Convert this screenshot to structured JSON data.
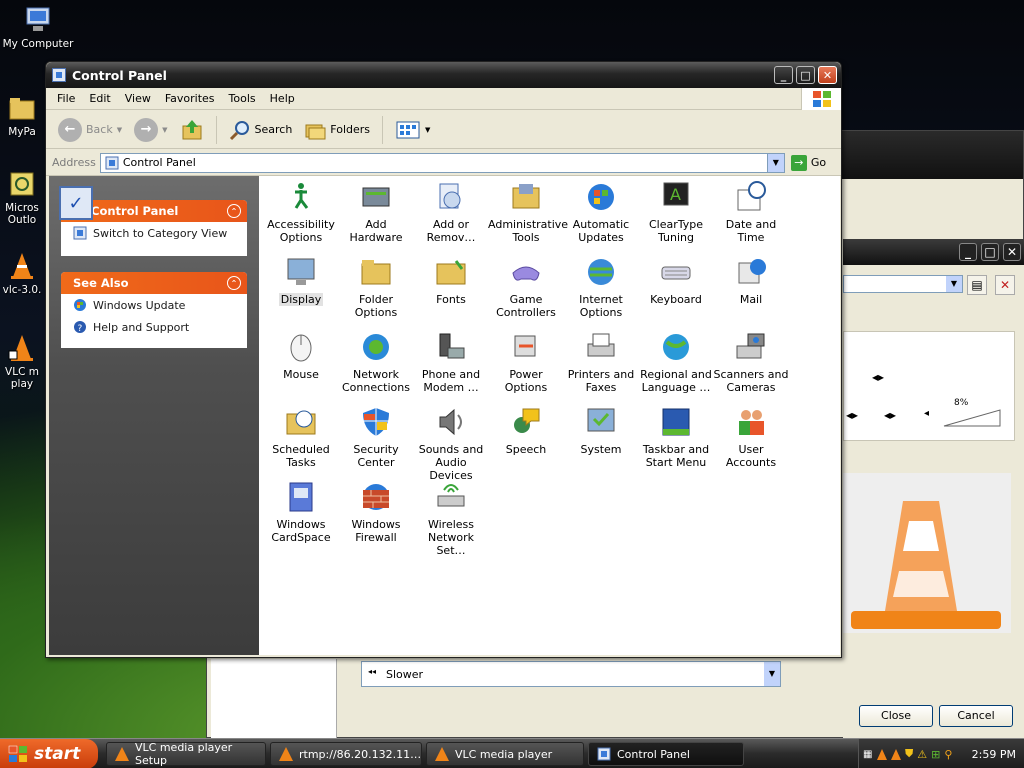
{
  "desktop": {
    "icons": [
      {
        "label": "My Computer",
        "icon": "my-computer-icon"
      },
      {
        "label": "MyPa",
        "icon": "folder-icon"
      },
      {
        "label": "Micros Outlo",
        "icon": "outlook-icon"
      },
      {
        "label": "vlc-3.0.",
        "icon": "vlc-cone-icon"
      },
      {
        "label": "VLC m play",
        "icon": "vlc-shortcut-icon"
      }
    ]
  },
  "control_panel": {
    "title": "Control Panel",
    "menu": [
      "File",
      "Edit",
      "View",
      "Favorites",
      "Tools",
      "Help"
    ],
    "toolbar": {
      "back": "Back",
      "search": "Search",
      "folders": "Folders"
    },
    "address": {
      "label": "Address",
      "value": "Control Panel",
      "go": "Go"
    },
    "pane": {
      "control_panel_header": "Control Panel",
      "switch_view": "Switch to Category View",
      "see_also_header": "See Also",
      "see_also_items": [
        "Windows Update",
        "Help and Support"
      ]
    },
    "items": [
      {
        "label": "Accessibility Options",
        "icon": "accessibility-icon"
      },
      {
        "label": "Add Hardware",
        "icon": "add-hardware-icon"
      },
      {
        "label": "Add or Remov…",
        "icon": "add-remove-programs-icon"
      },
      {
        "label": "Administrative Tools",
        "icon": "administrative-tools-icon"
      },
      {
        "label": "Automatic Updates",
        "icon": "automatic-updates-icon"
      },
      {
        "label": "ClearType Tuning",
        "icon": "cleartype-icon"
      },
      {
        "label": "Date and Time",
        "icon": "date-time-icon"
      },
      {
        "label": "Display",
        "icon": "display-icon"
      },
      {
        "label": "Folder Options",
        "icon": "folder-options-icon"
      },
      {
        "label": "Fonts",
        "icon": "fonts-icon"
      },
      {
        "label": "Game Controllers",
        "icon": "game-controller-icon"
      },
      {
        "label": "Internet Options",
        "icon": "internet-options-icon"
      },
      {
        "label": "Keyboard",
        "icon": "keyboard-icon"
      },
      {
        "label": "Mail",
        "icon": "mail-icon"
      },
      {
        "label": "Mouse",
        "icon": "mouse-icon"
      },
      {
        "label": "Network Connections",
        "icon": "network-connections-icon"
      },
      {
        "label": "Phone and Modem …",
        "icon": "phone-modem-icon"
      },
      {
        "label": "Power Options",
        "icon": "power-options-icon"
      },
      {
        "label": "Printers and Faxes",
        "icon": "printer-icon"
      },
      {
        "label": "Regional and Language …",
        "icon": "regional-language-icon"
      },
      {
        "label": "Scanners and Cameras",
        "icon": "scanner-camera-icon"
      },
      {
        "label": "Scheduled Tasks",
        "icon": "scheduled-tasks-icon"
      },
      {
        "label": "Security Center",
        "icon": "security-center-icon"
      },
      {
        "label": "Sounds and Audio Devices",
        "icon": "speaker-icon"
      },
      {
        "label": "Speech",
        "icon": "speech-icon"
      },
      {
        "label": "System",
        "icon": "system-icon"
      },
      {
        "label": "Taskbar and Start Menu",
        "icon": "taskbar-icon"
      },
      {
        "label": "User Accounts",
        "icon": "user-accounts-icon"
      },
      {
        "label": "Windows CardSpace",
        "icon": "cardspace-icon"
      },
      {
        "label": "Windows Firewall",
        "icon": "firewall-icon"
      },
      {
        "label": "Wireless Network Set…",
        "icon": "wireless-network-icon"
      }
    ]
  },
  "vlc_dialog": {
    "list_value": "Slower",
    "slider_value": "8%",
    "close_label": "Close",
    "cancel_label": "Cancel"
  },
  "taskbar": {
    "start_label": "start",
    "buttons": [
      {
        "label": "VLC media player Setup",
        "icon": "vlc-cone-icon"
      },
      {
        "label": "rtmp://86.20.132.11…",
        "icon": "vlc-cone-icon"
      },
      {
        "label": "VLC media player",
        "icon": "vlc-cone-icon"
      },
      {
        "label": "Control Panel",
        "icon": "control-panel-icon"
      }
    ],
    "clock": "2:59 PM"
  },
  "colors": {
    "pane_header": "#e8551a",
    "title_bar": "#262626",
    "start_button": "#e05a1e",
    "vlc_orange": "#f08418"
  }
}
